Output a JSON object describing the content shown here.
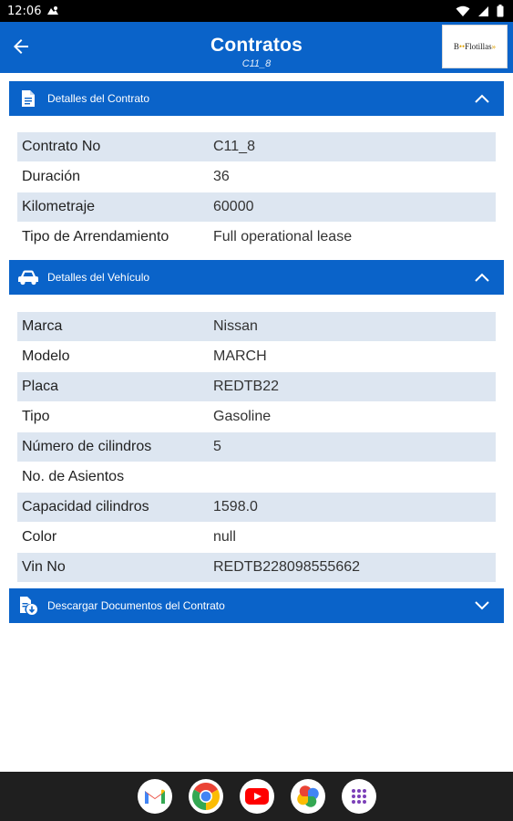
{
  "status_bar": {
    "time": "12:06"
  },
  "app_bar": {
    "title": "Contratos",
    "subtitle": "C11_8",
    "logo_text_main": "B",
    "logo_text_rest": "Flotillas"
  },
  "contract_section": {
    "title": "Detalles del Contrato",
    "rows": [
      {
        "label": "Contrato No",
        "value": "C11_8"
      },
      {
        "label": "Duración",
        "value": "36"
      },
      {
        "label": "Kilometraje",
        "value": "60000"
      },
      {
        "label": "Tipo de Arrendamiento",
        "value": "Full operational lease"
      }
    ]
  },
  "vehicle_section": {
    "title": "Detalles del Vehículo",
    "rows": [
      {
        "label": "Marca",
        "value": "Nissan"
      },
      {
        "label": "Modelo",
        "value": "MARCH"
      },
      {
        "label": "Placa",
        "value": "REDTB22"
      },
      {
        "label": "Tipo",
        "value": "Gasoline"
      },
      {
        "label": "Número de cilindros",
        "value": "5"
      },
      {
        "label": "No. de Asientos",
        "value": ""
      },
      {
        "label": "Capacidad cilindros",
        "value": "1598.0"
      },
      {
        "label": "Color",
        "value": "null"
      },
      {
        "label": "Vin No",
        "value": "REDTB228098555662"
      }
    ]
  },
  "documents_section": {
    "title": "Descargar Documentos del Contrato"
  },
  "colors": {
    "primary": "#0a63c9",
    "row_alt": "#dde6f1"
  },
  "dock": [
    "gmail-icon",
    "chrome-icon",
    "youtube-icon",
    "photos-icon",
    "apps-icon"
  ]
}
